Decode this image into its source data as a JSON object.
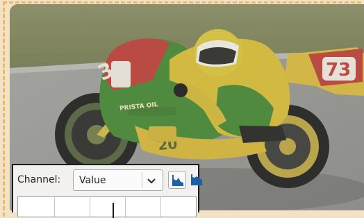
{
  "panel": {
    "channel_label": "Channel:",
    "channel_value": "Value",
    "linear_histogram_icon": "linear-histogram-icon",
    "log_histogram_icon": "logarithmic-histogram-icon"
  },
  "photo": {
    "left_number": "3",
    "right_number": "73",
    "brand_text": "PRISTA OIL"
  },
  "colors": {
    "frame_dash": "#e9b96e",
    "panel_bg": "#f2f1ef",
    "icon_blue": "#1f5fa8"
  }
}
